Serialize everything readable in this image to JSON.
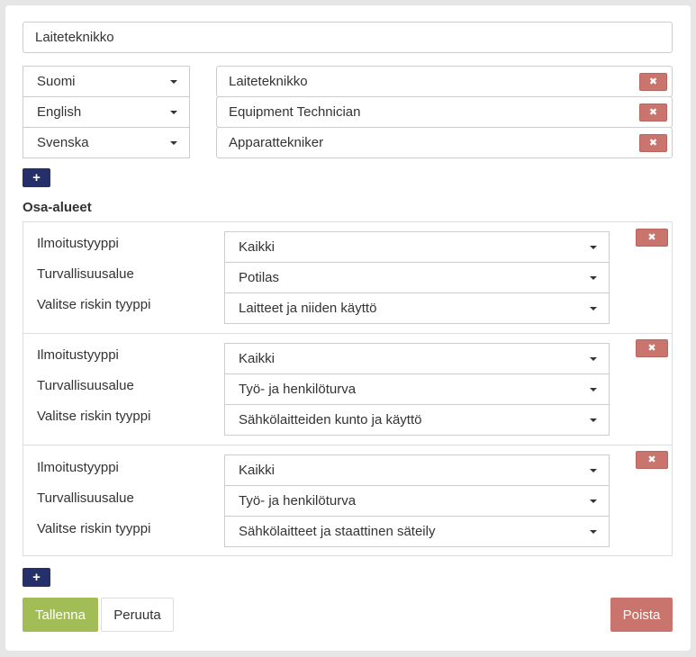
{
  "name_field": {
    "value": "Laiteteknikko"
  },
  "translations": [
    {
      "language": "Suomi",
      "value": "Laiteteknikko"
    },
    {
      "language": "English",
      "value": "Equipment Technician"
    },
    {
      "language": "Svenska",
      "value": "Apparattekniker"
    }
  ],
  "icons": {
    "remove": "times-icon",
    "add": "plus-icon",
    "dropdown": "caret-down-icon"
  },
  "remove_glyph": "✖",
  "add_glyph": "+",
  "subareas": {
    "title": "Osa-alueet",
    "labels": {
      "report_type": "Ilmoitustyyppi",
      "safety_area": "Turvallisuusalue",
      "risk_type": "Valitse riskin tyyppi"
    },
    "groups": [
      {
        "report_type": "Kaikki",
        "safety_area": "Potilas",
        "risk_type": "Laitteet ja niiden käyttö"
      },
      {
        "report_type": "Kaikki",
        "safety_area": "Työ- ja henkilöturva",
        "risk_type": "Sähkölaitteiden kunto ja käyttö"
      },
      {
        "report_type": "Kaikki",
        "safety_area": "Työ- ja henkilöturva",
        "risk_type": "Sähkölaitteet ja staattinen säteily"
      }
    ]
  },
  "actions": {
    "save": "Tallenna",
    "cancel": "Peruuta",
    "delete": "Poista"
  },
  "colors": {
    "primary_add": "#25306b",
    "danger": "#c9756d",
    "success": "#a2bc56",
    "border": "#cccccc"
  }
}
